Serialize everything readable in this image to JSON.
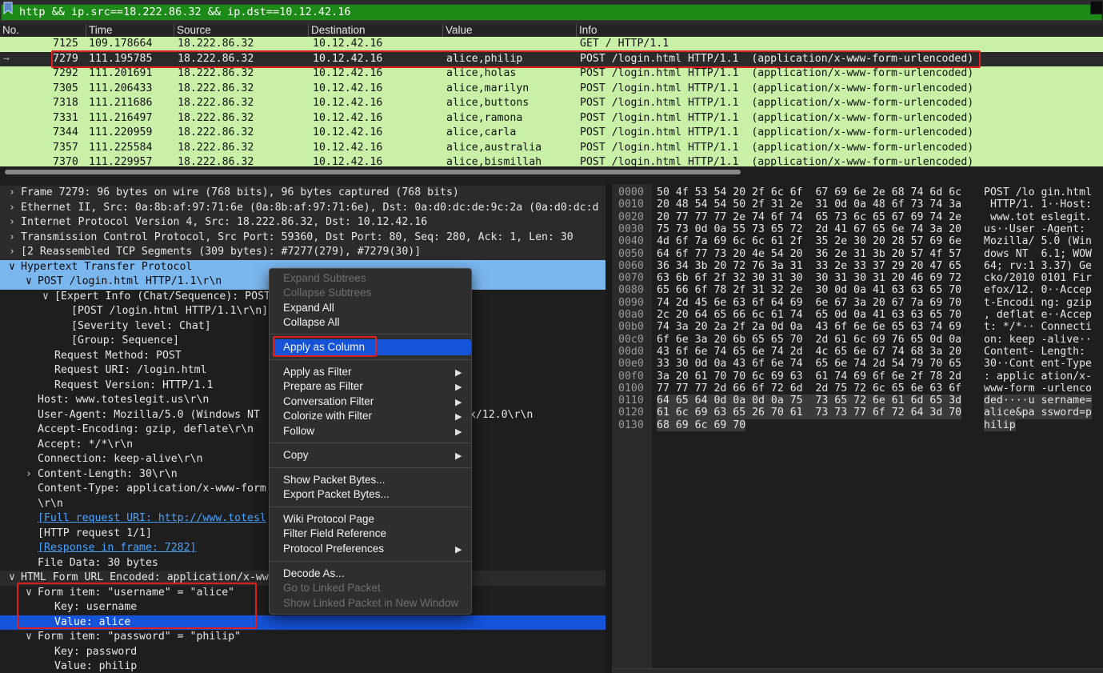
{
  "filter": {
    "value": "http && ip.src==18.222.86.32 && ip.dst==10.12.42.16"
  },
  "columns": [
    "No.",
    "Time",
    "Source",
    "Destination",
    "Value",
    "Info"
  ],
  "packets": [
    {
      "no": "7125",
      "time": "109.178664",
      "src": "18.222.86.32",
      "dst": "10.12.42.16",
      "value": "",
      "info": "GET / HTTP/1.1"
    },
    {
      "no": "7279",
      "time": "111.195785",
      "src": "18.222.86.32",
      "dst": "10.12.42.16",
      "value": "alice,philip",
      "info": "POST /login.html HTTP/1.1  (application/x-www-form-urlencoded)"
    },
    {
      "no": "7292",
      "time": "111.201691",
      "src": "18.222.86.32",
      "dst": "10.12.42.16",
      "value": "alice,holas",
      "info": "POST /login.html HTTP/1.1  (application/x-www-form-urlencoded)"
    },
    {
      "no": "7305",
      "time": "111.206433",
      "src": "18.222.86.32",
      "dst": "10.12.42.16",
      "value": "alice,marilyn",
      "info": "POST /login.html HTTP/1.1  (application/x-www-form-urlencoded)"
    },
    {
      "no": "7318",
      "time": "111.211686",
      "src": "18.222.86.32",
      "dst": "10.12.42.16",
      "value": "alice,buttons",
      "info": "POST /login.html HTTP/1.1  (application/x-www-form-urlencoded)"
    },
    {
      "no": "7331",
      "time": "111.216497",
      "src": "18.222.86.32",
      "dst": "10.12.42.16",
      "value": "alice,ramona",
      "info": "POST /login.html HTTP/1.1  (application/x-www-form-urlencoded)"
    },
    {
      "no": "7344",
      "time": "111.220959",
      "src": "18.222.86.32",
      "dst": "10.12.42.16",
      "value": "alice,carla",
      "info": "POST /login.html HTTP/1.1  (application/x-www-form-urlencoded)"
    },
    {
      "no": "7357",
      "time": "111.225584",
      "src": "18.222.86.32",
      "dst": "10.12.42.16",
      "value": "alice,australia",
      "info": "POST /login.html HTTP/1.1  (application/x-www-form-urlencoded)"
    },
    {
      "no": "7370",
      "time": "111.229957",
      "src": "18.222.86.32",
      "dst": "10.12.42.16",
      "value": "alice,bismillah",
      "info": "POST /login.html HTTP/1.1  (application/x-www-form-urlencoded)"
    }
  ],
  "details": [
    {
      "arrow": ">",
      "text": "Frame 7279: 96 bytes on wire (768 bits), 96 bytes captured (768 bits)"
    },
    {
      "arrow": ">",
      "text": "Ethernet II, Src: 0a:8b:af:97:71:6e (0a:8b:af:97:71:6e), Dst: 0a:d0:dc:de:9c:2a (0a:d0:dc:d"
    },
    {
      "arrow": ">",
      "text": "Internet Protocol Version 4, Src: 18.222.86.32, Dst: 10.12.42.16"
    },
    {
      "arrow": ">",
      "text": "Transmission Control Protocol, Src Port: 59360, Dst Port: 80, Seq: 280, Ack: 1, Len: 30"
    },
    {
      "arrow": ">",
      "text": "[2 Reassembled TCP Segments (309 bytes): #7277(279), #7279(30)]"
    },
    {
      "arrow": "v",
      "text": "Hypertext Transfer Protocol"
    },
    {
      "arrow": "v",
      "text": "POST /login.html HTTP/1.1\\r\\n"
    },
    {
      "arrow": "v",
      "text": "[Expert Info (Chat/Sequence): POST"
    },
    {
      "arrow": "",
      "text": "[POST /login.html HTTP/1.1\\r\\n]"
    },
    {
      "arrow": "",
      "text": "[Severity level: Chat]"
    },
    {
      "arrow": "",
      "text": "[Group: Sequence]"
    },
    {
      "arrow": "",
      "text": "Request Method: POST"
    },
    {
      "arrow": "",
      "text": "Request URI: /login.html"
    },
    {
      "arrow": "",
      "text": "Request Version: HTTP/1.1"
    },
    {
      "arrow": "",
      "text": "Host: www.toteslegit.us\\r\\n"
    },
    {
      "arrow": "",
      "text": "User-Agent: Mozilla/5.0 (Windows NT                     )0101 Firefox/12.0\\r\\n"
    },
    {
      "arrow": "",
      "text": "Accept-Encoding: gzip, deflate\\r\\n"
    },
    {
      "arrow": "",
      "text": "Accept: */*\\r\\n"
    },
    {
      "arrow": "",
      "text": "Connection: keep-alive\\r\\n"
    },
    {
      "arrow": ">",
      "text": "Content-Length: 30\\r\\n"
    },
    {
      "arrow": "",
      "text": "Content-Type: application/x-www-form"
    },
    {
      "arrow": "",
      "text": "\\r\\n"
    },
    {
      "arrow": "",
      "text": "[Full request URI: http://www.totesl"
    },
    {
      "arrow": "",
      "text": "[HTTP request 1/1]"
    },
    {
      "arrow": "",
      "text": "[Response in frame: 7282]"
    },
    {
      "arrow": "",
      "text": "File Data: 30 bytes"
    },
    {
      "arrow": "v",
      "text": "HTML Form URL Encoded: application/x-ww"
    },
    {
      "arrow": "v",
      "text": "Form item: \"username\" = \"alice\""
    },
    {
      "arrow": "",
      "text": "Key: username"
    },
    {
      "arrow": "",
      "text": "Value: alice"
    },
    {
      "arrow": "v",
      "text": "Form item: \"password\" = \"philip\""
    },
    {
      "arrow": "",
      "text": "Key: password"
    },
    {
      "arrow": "",
      "text": "Value: philip"
    }
  ],
  "bytes": [
    {
      "off": "0000",
      "hex": "50 4f 53 54 20 2f 6c 6f  67 69 6e 2e 68 74 6d 6c",
      "ascii": "POST /lo gin.html"
    },
    {
      "off": "0010",
      "hex": "20 48 54 54 50 2f 31 2e  31 0d 0a 48 6f 73 74 3a",
      "ascii": " HTTP/1. 1··Host:"
    },
    {
      "off": "0020",
      "hex": "20 77 77 77 2e 74 6f 74  65 73 6c 65 67 69 74 2e",
      "ascii": " www.tot eslegit."
    },
    {
      "off": "0030",
      "hex": "75 73 0d 0a 55 73 65 72  2d 41 67 65 6e 74 3a 20",
      "ascii": "us··User -Agent: "
    },
    {
      "off": "0040",
      "hex": "4d 6f 7a 69 6c 6c 61 2f  35 2e 30 20 28 57 69 6e",
      "ascii": "Mozilla/ 5.0 (Win"
    },
    {
      "off": "0050",
      "hex": "64 6f 77 73 20 4e 54 20  36 2e 31 3b 20 57 4f 57",
      "ascii": "dows NT  6.1; WOW"
    },
    {
      "off": "0060",
      "hex": "36 34 3b 20 72 76 3a 31  33 2e 33 37 29 20 47 65",
      "ascii": "64; rv:1 3.37) Ge"
    },
    {
      "off": "0070",
      "hex": "63 6b 6f 2f 32 30 31 30  30 31 30 31 20 46 69 72",
      "ascii": "cko/2010 0101 Fir"
    },
    {
      "off": "0080",
      "hex": "65 66 6f 78 2f 31 32 2e  30 0d 0a 41 63 63 65 70",
      "ascii": "efox/12. 0··Accep"
    },
    {
      "off": "0090",
      "hex": "74 2d 45 6e 63 6f 64 69  6e 67 3a 20 67 7a 69 70",
      "ascii": "t-Encodi ng: gzip"
    },
    {
      "off": "00a0",
      "hex": "2c 20 64 65 66 6c 61 74  65 0d 0a 41 63 63 65 70",
      "ascii": ", deflat e··Accep"
    },
    {
      "off": "00b0",
      "hex": "74 3a 20 2a 2f 2a 0d 0a  43 6f 6e 6e 65 63 74 69",
      "ascii": "t: */*·· Connecti"
    },
    {
      "off": "00c0",
      "hex": "6f 6e 3a 20 6b 65 65 70  2d 61 6c 69 76 65 0d 0a",
      "ascii": "on: keep -alive··"
    },
    {
      "off": "00d0",
      "hex": "43 6f 6e 74 65 6e 74 2d  4c 65 6e 67 74 68 3a 20",
      "ascii": "Content- Length: "
    },
    {
      "off": "00e0",
      "hex": "33 30 0d 0a 43 6f 6e 74  65 6e 74 2d 54 79 70 65",
      "ascii": "30··Cont ent-Type"
    },
    {
      "off": "00f0",
      "hex": "3a 20 61 70 70 6c 69 63  61 74 69 6f 6e 2f 78 2d",
      "ascii": ": applic ation/x-"
    },
    {
      "off": "0100",
      "hex": "77 77 77 2d 66 6f 72 6d  2d 75 72 6c 65 6e 63 6f",
      "ascii": "www-form -urlenco"
    },
    {
      "off": "0110",
      "hex": "64 65 64 0d 0a 0d 0a 75  73 65 72 6e 61 6d 65 3d",
      "ascii": "ded····u sername="
    },
    {
      "off": "0120",
      "hex": "61 6c 69 63 65 26 70 61  73 73 77 6f 72 64 3d 70",
      "ascii": "alice&pa ssword=p"
    },
    {
      "off": "0130",
      "hex": "68 69 6c 69 70",
      "ascii": "hilip"
    }
  ],
  "context_menu": {
    "expand_subtrees": "Expand Subtrees",
    "collapse_subtrees": "Collapse Subtrees",
    "expand_all": "Expand All",
    "collapse_all": "Collapse All",
    "apply_as_column": "Apply as Column",
    "apply_as_filter": "Apply as Filter",
    "prepare_as_filter": "Prepare as Filter",
    "conversation_filter": "Conversation Filter",
    "colorize_with_filter": "Colorize with Filter",
    "follow": "Follow",
    "copy": "Copy",
    "show_packet_bytes": "Show Packet Bytes...",
    "export_packet_bytes": "Export Packet Bytes...",
    "wiki_protocol_page": "Wiki Protocol Page",
    "filter_field_reference": "Filter Field Reference",
    "protocol_preferences": "Protocol Preferences",
    "decode_as": "Decode As...",
    "go_to_linked_packet": "Go to Linked Packet",
    "show_linked_packet": "Show Linked Packet in New Window"
  },
  "colors": {
    "filter_valid": "#1c8a16",
    "packet_http": "#c8f0a6",
    "tree_highlight": "#7ab7ef",
    "selection": "#1553d8",
    "annotation": "#e11d1d"
  },
  "icons": {
    "bookmark": "bookmark-icon",
    "clear": "clear-filter-icon",
    "submenu": "triangle-right-icon"
  }
}
